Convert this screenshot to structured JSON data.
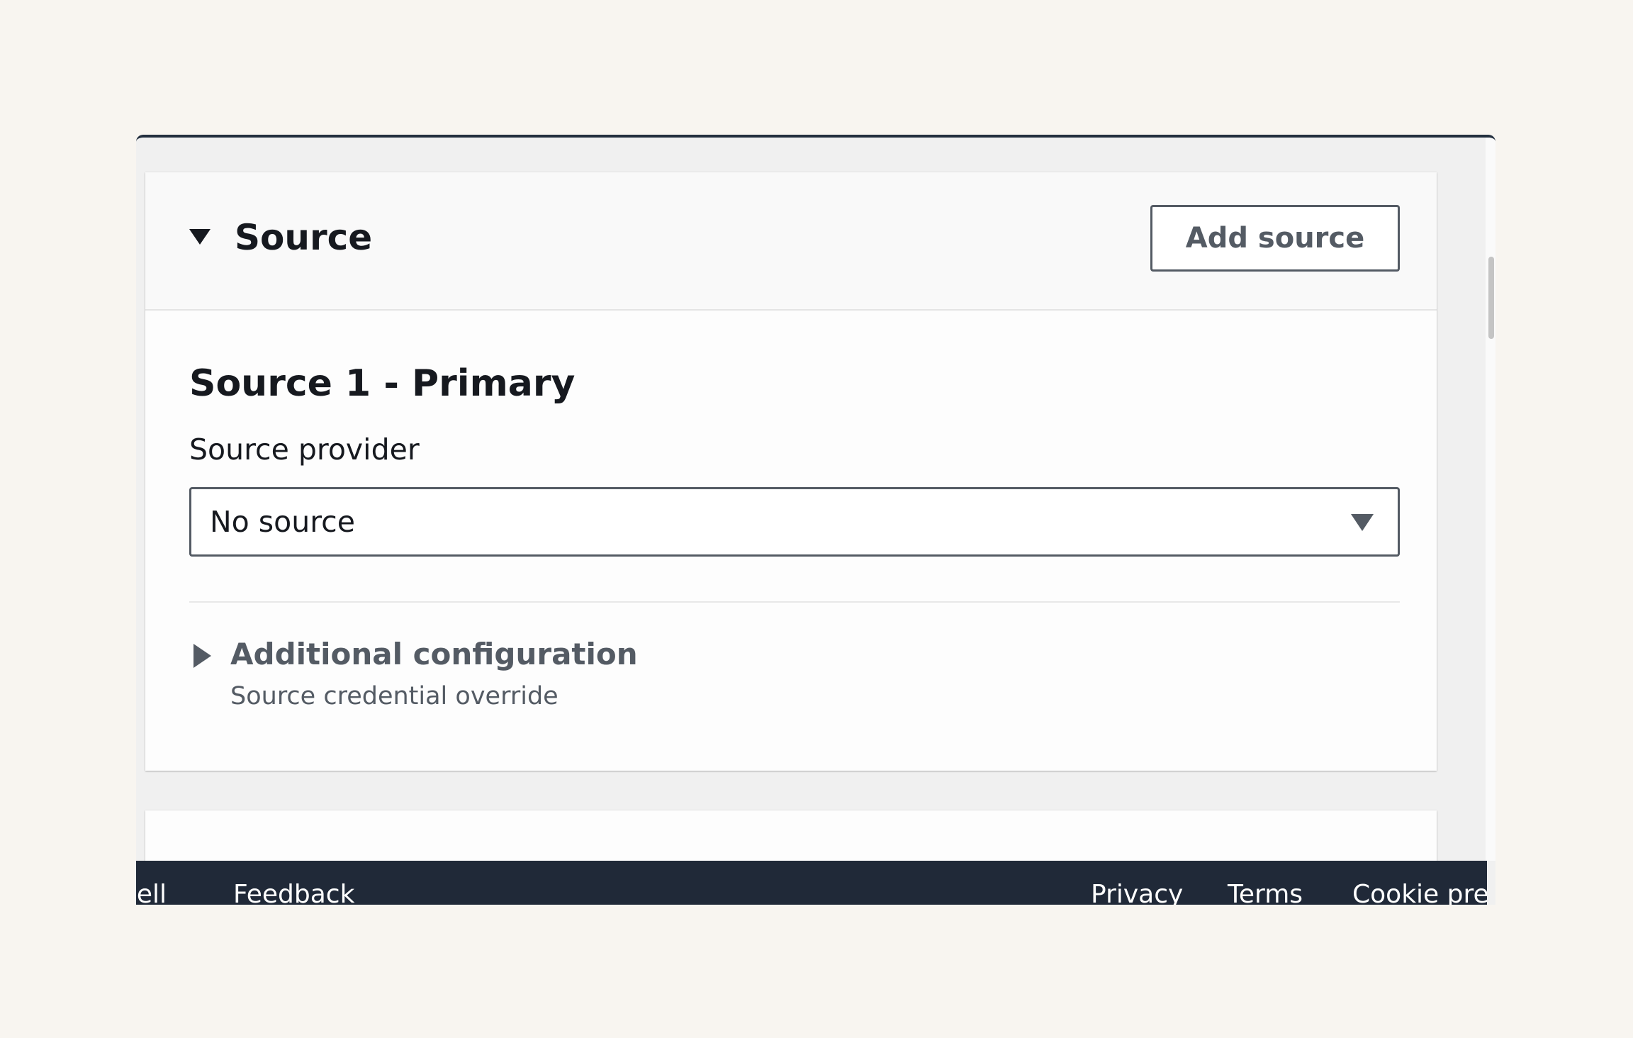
{
  "section": {
    "title": "Source",
    "add_button_label": "Add source"
  },
  "source": {
    "heading": "Source 1 - Primary",
    "provider_label": "Source provider",
    "provider_value": "No source"
  },
  "additional": {
    "title": "Additional configuration",
    "description": "Source credential override"
  },
  "footer": {
    "shell_label": "hell",
    "feedback_label": "Feedback",
    "privacy_label": "Privacy",
    "terms_label": "Terms",
    "cookie_label": "Cookie pref"
  }
}
